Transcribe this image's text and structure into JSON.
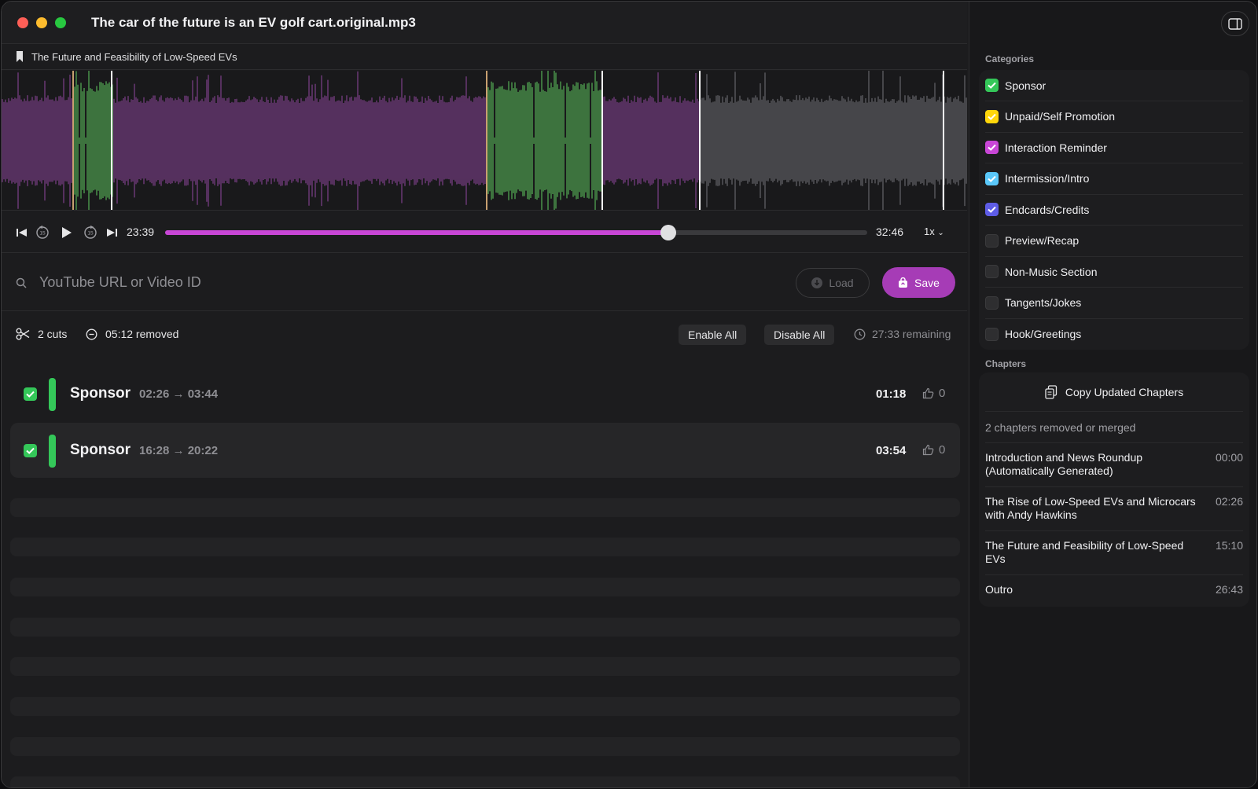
{
  "window": {
    "title": "The car of the future is an EV golf cart.original.mp3",
    "current_chapter": "The Future and Feasibility of Low-Speed EVs"
  },
  "colors": {
    "accent": "#c846d6",
    "sponsor_green": "#34c759",
    "self_promo_yellow": "#ffd60a",
    "interaction_purple": "#c846d6",
    "intro_cyan": "#5ac8fa",
    "credits_blue": "#5e5ce6"
  },
  "transport": {
    "current_time": "23:39",
    "total_time": "32:46",
    "progress_fraction": 0.717,
    "speed": "1x"
  },
  "url_bar": {
    "placeholder": "YouTube URL or Video ID",
    "value": "",
    "load_label": "Load",
    "save_label": "Save"
  },
  "stats": {
    "cuts": "2 cuts",
    "removed": "05:12 removed",
    "enable_all": "Enable All",
    "disable_all": "Disable All",
    "remaining": "27:33 remaining"
  },
  "segments": [
    {
      "category": "Sponsor",
      "start": "02:26",
      "end": "03:44",
      "duration": "01:18",
      "votes": "0",
      "enabled": true
    },
    {
      "category": "Sponsor",
      "start": "16:28",
      "end": "20:22",
      "duration": "03:54",
      "votes": "0",
      "enabled": true
    }
  ],
  "sidebar": {
    "categories_title": "Categories",
    "categories": [
      {
        "label": "Sponsor",
        "checked": true,
        "color": "#34c759"
      },
      {
        "label": "Unpaid/Self Promotion",
        "checked": true,
        "color": "#ffd60a"
      },
      {
        "label": "Interaction Reminder",
        "checked": true,
        "color": "#c846d6"
      },
      {
        "label": "Intermission/Intro",
        "checked": true,
        "color": "#5ac8fa"
      },
      {
        "label": "Endcards/Credits",
        "checked": true,
        "color": "#5e5ce6"
      },
      {
        "label": "Preview/Recap",
        "checked": false,
        "color": ""
      },
      {
        "label": "Non-Music Section",
        "checked": false,
        "color": ""
      },
      {
        "label": "Tangents/Jokes",
        "checked": false,
        "color": ""
      },
      {
        "label": "Hook/Greetings",
        "checked": false,
        "color": ""
      }
    ],
    "chapters_title": "Chapters",
    "copy_label": "Copy Updated Chapters",
    "chapters_note": "2 chapters removed or merged",
    "chapters": [
      {
        "title": "Introduction and News Roundup (Automatically Generated)",
        "time": "00:00"
      },
      {
        "title": "The Rise of Low-Speed EVs and Microcars with Andy Hawkins",
        "time": "02:26"
      },
      {
        "title": "The Future and Feasibility of Low-Speed EVs",
        "time": "15:10"
      },
      {
        "title": "Outro",
        "time": "26:43"
      }
    ]
  }
}
